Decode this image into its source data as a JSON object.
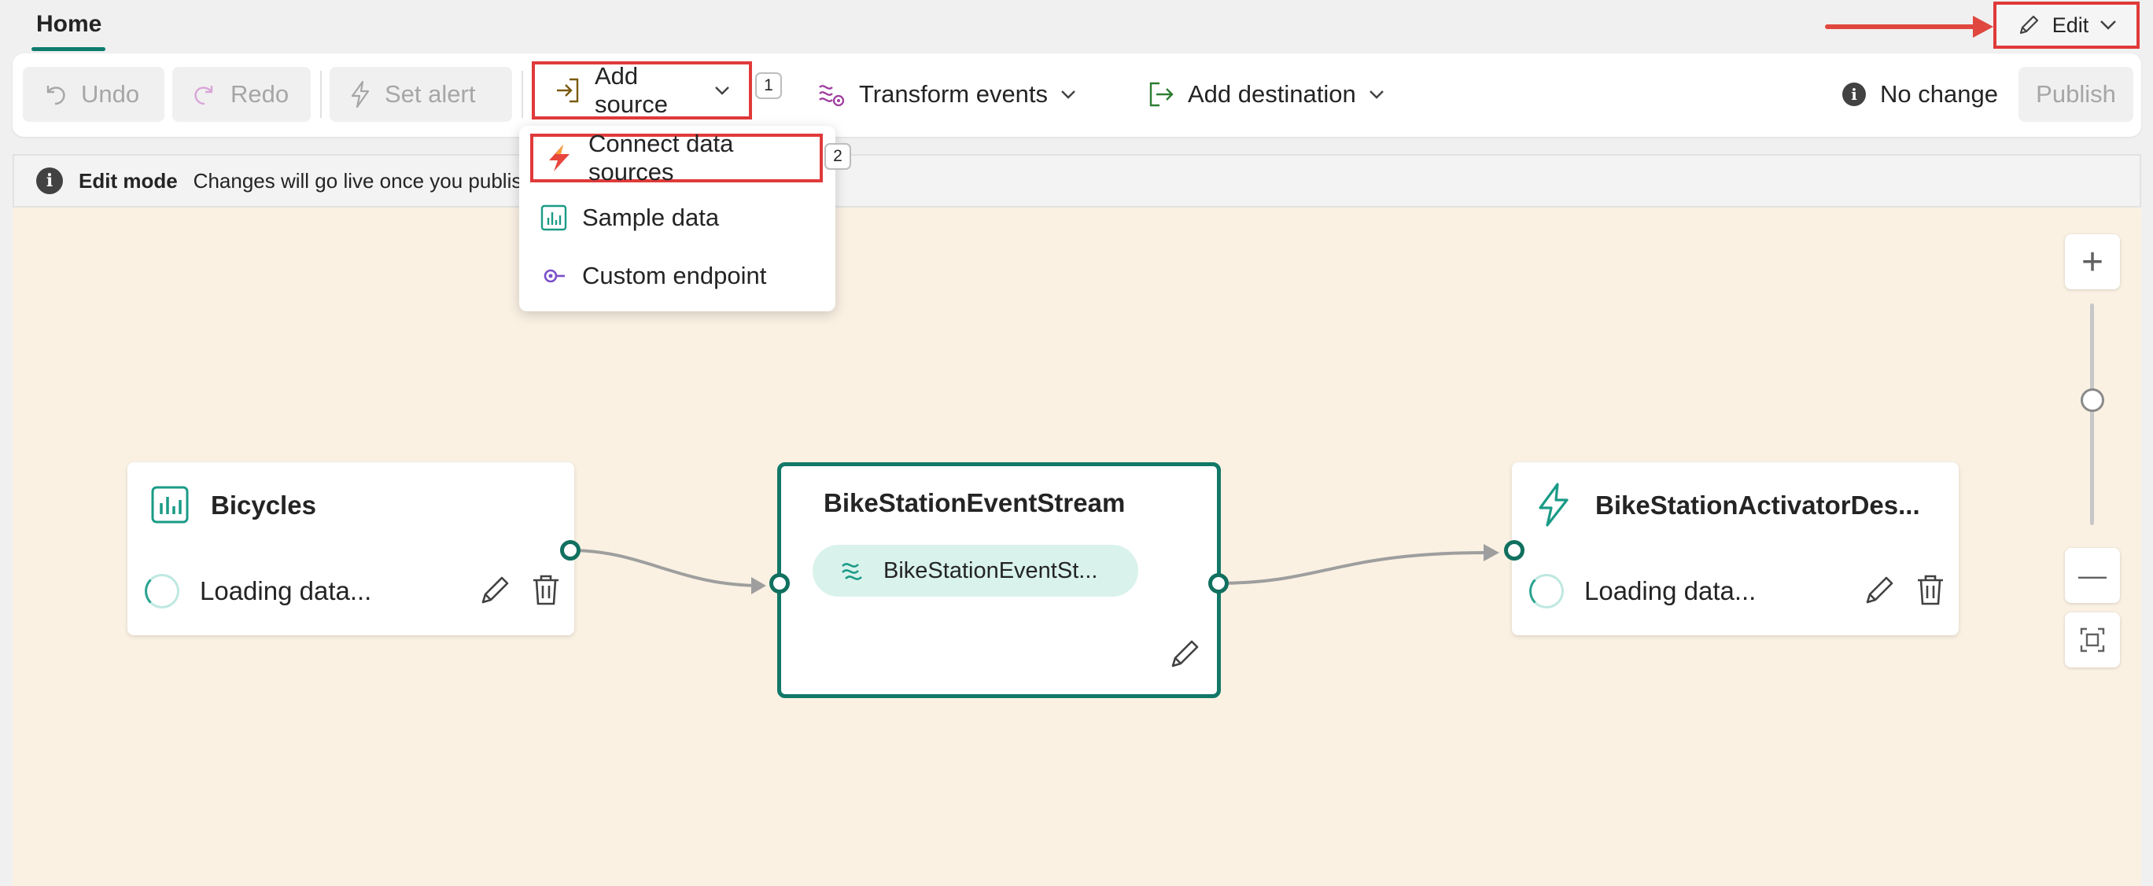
{
  "header": {
    "tab_home": "Home",
    "edit_label": "Edit"
  },
  "toolbar": {
    "undo": "Undo",
    "redo": "Redo",
    "set_alert": "Set alert",
    "add_source": "Add source",
    "add_source_badge": "1",
    "transform_events": "Transform events",
    "add_destination": "Add destination",
    "status": "No change",
    "publish": "Publish"
  },
  "infobar": {
    "mode": "Edit mode",
    "message": "Changes will go live once you publis"
  },
  "add_source_menu": {
    "items": [
      {
        "label": "Connect data sources",
        "icon": "lightning-icon",
        "badge": "2"
      },
      {
        "label": "Sample data",
        "icon": "chart-icon"
      },
      {
        "label": "Custom endpoint",
        "icon": "endpoint-icon"
      }
    ]
  },
  "nodes": {
    "source": {
      "title": "Bicycles",
      "status": "Loading data..."
    },
    "eventstream": {
      "title": "BikeStationEventStream",
      "pill": "BikeStationEventSt..."
    },
    "destination": {
      "title": "BikeStationActivatorDes...",
      "status": "Loading data..."
    }
  },
  "zoom": {
    "zoom_in": "+",
    "zoom_out": "—",
    "level": 0.75
  },
  "colors": {
    "accent": "#0f7b6c",
    "highlight": "#e03a3a",
    "canvas": "#faf1e3"
  }
}
